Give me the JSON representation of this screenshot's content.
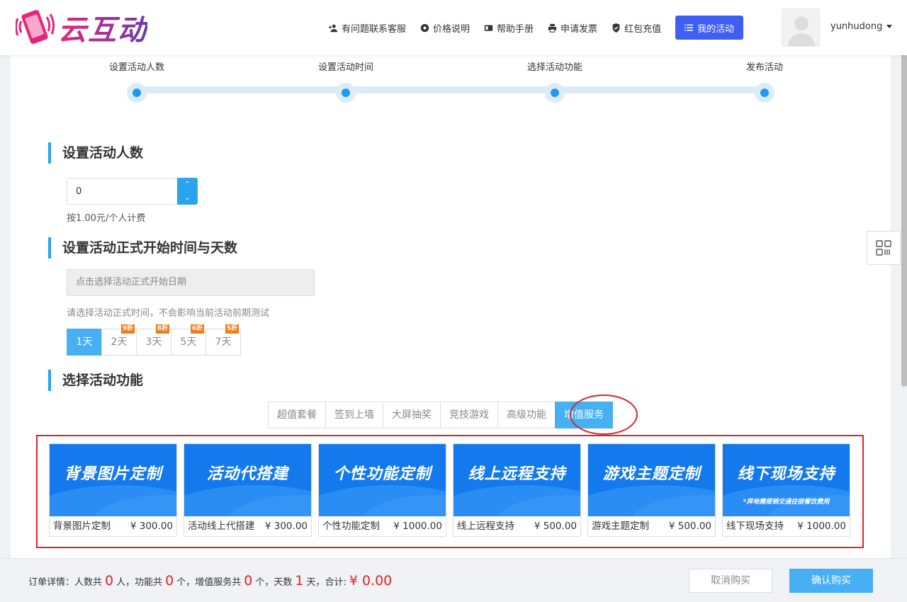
{
  "header": {
    "logo_text": "云互动",
    "nav": [
      {
        "label": "有问题联系客服",
        "icon": "user-plus-icon"
      },
      {
        "label": "价格说明",
        "icon": "gear-icon"
      },
      {
        "label": "帮助手册",
        "icon": "book-icon"
      },
      {
        "label": "申请发票",
        "icon": "printer-icon"
      },
      {
        "label": "红包充值",
        "icon": "shield-check-icon"
      }
    ],
    "my_activity_label": "我的活动",
    "username": "yunhudong",
    "colors": {
      "primary_button": "#3f5ef3",
      "accent": "#29a4ef"
    }
  },
  "steps": [
    "设置活动人数",
    "设置活动时间",
    "选择活动功能",
    "发布活动"
  ],
  "people_section": {
    "title": "设置活动人数",
    "value": "0",
    "hint": "按1.00元/个人计费"
  },
  "time_section": {
    "title": "设置活动正式开始时间与天数",
    "date_placeholder": "点击选择活动正式开始日期",
    "hint": "请选择活动正式时间，不会影响当前活动前期测试",
    "days": [
      {
        "label": "1天",
        "badge": "",
        "active": true
      },
      {
        "label": "2天",
        "badge": "9折",
        "active": false
      },
      {
        "label": "3天",
        "badge": "8折",
        "active": false
      },
      {
        "label": "5天",
        "badge": "6折",
        "active": false
      },
      {
        "label": "7天",
        "badge": "5折",
        "active": false
      }
    ]
  },
  "function_section": {
    "title": "选择活动功能",
    "tabs": [
      "超值套餐",
      "签到上墙",
      "大屏抽奖",
      "竞技游戏",
      "高级功能",
      "增值服务"
    ],
    "active_tab": "增值服务",
    "services": [
      {
        "banner": "背景图片定制",
        "note": "",
        "name": "背景图片定制",
        "price": "¥ 300.00"
      },
      {
        "banner": "活动代搭建",
        "note": "",
        "name": "活动线上代搭建",
        "price": "¥ 300.00"
      },
      {
        "banner": "个性功能定制",
        "note": "",
        "name": "个性功能定制",
        "price": "¥ 1000.00"
      },
      {
        "banner": "线上远程支持",
        "note": "",
        "name": "线上远程支持",
        "price": "¥ 500.00"
      },
      {
        "banner": "游戏主题定制",
        "note": "",
        "name": "游戏主题定制",
        "price": "¥ 500.00"
      },
      {
        "banner": "线下现场支持",
        "note": "*异地需报销交通住宿餐饮费用",
        "name": "线下现场支持",
        "price": "¥ 1000.00"
      }
    ]
  },
  "footer": {
    "order_label": "订单详情：人数共",
    "people_count": "0",
    "people_unit": "人，功能共",
    "function_count": "0",
    "function_unit": "个，增值服务共",
    "service_count": "0",
    "service_unit": "个，天数",
    "days_count": "1",
    "days_unit": "天，合计:",
    "total": "¥ 0.00",
    "cancel_label": "取消购买",
    "confirm_label": "确认购买"
  }
}
